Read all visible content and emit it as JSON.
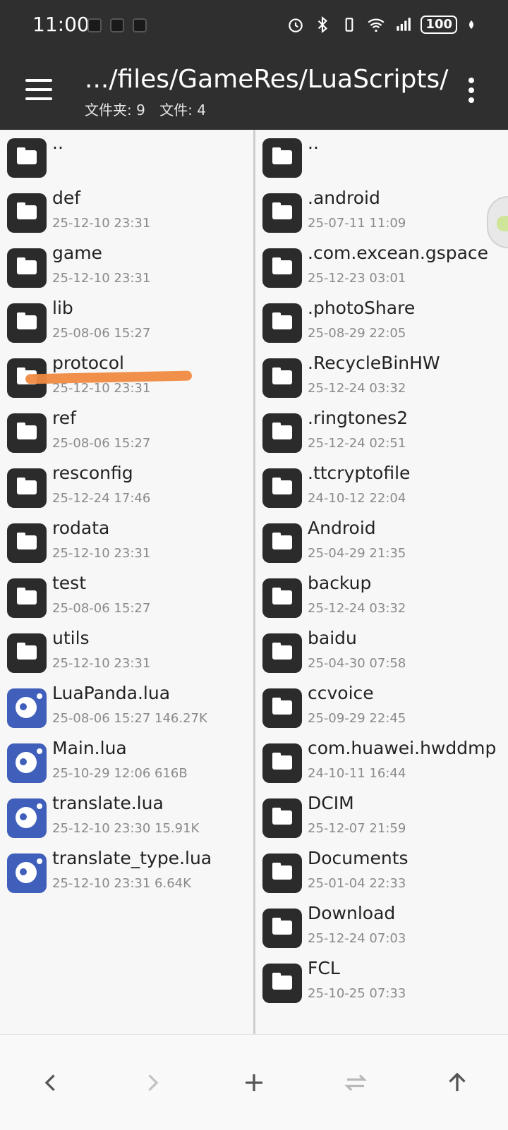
{
  "status_bar": {
    "time": "11:00",
    "battery": "100",
    "icons": [
      "app-notification-icon",
      "app-notification-icon",
      "app-notification-icon",
      "alarm-icon",
      "bluetooth-icon",
      "vibrate-icon",
      "wifi-icon",
      "signal-4g-icon",
      "battery-icon",
      "leaf-icon"
    ]
  },
  "app_bar": {
    "path": ".../files/GameRes/LuaScripts/",
    "folders_label": "文件夹: 9",
    "files_label": "文件: 4"
  },
  "left_pane": {
    "items": [
      {
        "name": "..",
        "meta": "",
        "type": "folder"
      },
      {
        "name": "def",
        "meta": "25-12-10 23:31",
        "type": "folder"
      },
      {
        "name": "game",
        "meta": "25-12-10 23:31",
        "type": "folder"
      },
      {
        "name": "lib",
        "meta": "25-08-06 15:27",
        "type": "folder"
      },
      {
        "name": "protocol",
        "meta": "25-12-10 23:31",
        "type": "folder"
      },
      {
        "name": "ref",
        "meta": "25-08-06 15:27",
        "type": "folder"
      },
      {
        "name": "resconfig",
        "meta": "25-12-24 17:46",
        "type": "folder"
      },
      {
        "name": "rodata",
        "meta": "25-12-10 23:31",
        "type": "folder"
      },
      {
        "name": "test",
        "meta": "25-08-06 15:27",
        "type": "folder"
      },
      {
        "name": "utils",
        "meta": "25-12-10 23:31",
        "type": "folder"
      },
      {
        "name": "LuaPanda.lua",
        "meta": "25-08-06 15:27  146.27K",
        "type": "lua"
      },
      {
        "name": "Main.lua",
        "meta": "25-10-29 12:06  616B",
        "type": "lua"
      },
      {
        "name": "translate.lua",
        "meta": "25-12-10 23:30  15.91K",
        "type": "lua"
      },
      {
        "name": "translate_type.lua",
        "meta": "25-12-10 23:31  6.64K",
        "type": "lua"
      }
    ]
  },
  "right_pane": {
    "items": [
      {
        "name": "..",
        "meta": "",
        "type": "folder"
      },
      {
        "name": ".android",
        "meta": "25-07-11 11:09",
        "type": "folder"
      },
      {
        "name": ".com.excean.gspace",
        "meta": "25-12-23 03:01",
        "type": "folder"
      },
      {
        "name": ".photoShare",
        "meta": "25-08-29 22:05",
        "type": "folder"
      },
      {
        "name": ".RecycleBinHW",
        "meta": "25-12-24 03:32",
        "type": "folder"
      },
      {
        "name": ".ringtones2",
        "meta": "25-12-24 02:51",
        "type": "folder"
      },
      {
        "name": ".ttcryptofile",
        "meta": "24-10-12 22:04",
        "type": "folder"
      },
      {
        "name": "Android",
        "meta": "25-04-29 21:35",
        "type": "folder"
      },
      {
        "name": "backup",
        "meta": "25-12-24 03:32",
        "type": "folder"
      },
      {
        "name": "baidu",
        "meta": "25-04-30 07:58",
        "type": "folder"
      },
      {
        "name": "ccvoice",
        "meta": "25-09-29 22:45",
        "type": "folder"
      },
      {
        "name": "com.huawei.hwddmp",
        "meta": "24-10-11 16:44",
        "type": "folder"
      },
      {
        "name": "DCIM",
        "meta": "25-12-07 21:59",
        "type": "folder"
      },
      {
        "name": "Documents",
        "meta": "25-01-04 22:33",
        "type": "folder"
      },
      {
        "name": "Download",
        "meta": "25-12-24 07:03",
        "type": "folder"
      },
      {
        "name": "FCL",
        "meta": "25-10-25 07:33",
        "type": "folder"
      }
    ]
  },
  "bottom_bar": {
    "buttons": [
      {
        "icon": "back-arrow-icon",
        "enabled": true
      },
      {
        "icon": "forward-arrow-icon",
        "enabled": false
      },
      {
        "icon": "plus-icon",
        "enabled": true
      },
      {
        "icon": "swap-panes-icon",
        "enabled": false
      },
      {
        "icon": "up-arrow-icon",
        "enabled": true
      }
    ]
  },
  "colors": {
    "bar": "#2f2f2f",
    "folder_icon_bg": "#2b2b2b",
    "lua_icon_bg": "#3f5fba",
    "marker": "#ef8a41"
  }
}
